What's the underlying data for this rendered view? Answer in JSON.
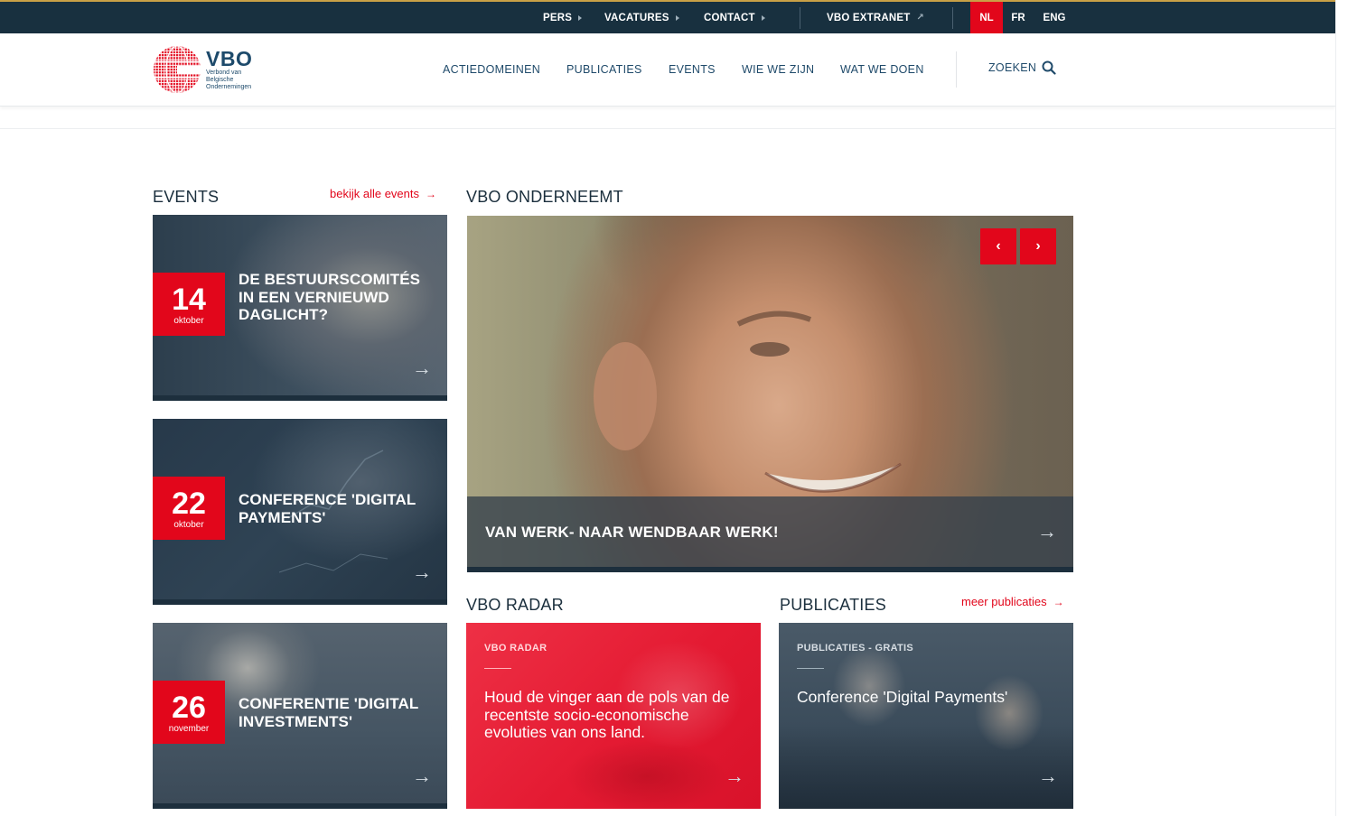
{
  "topbar": {
    "links": [
      "PERS",
      "VACATURES",
      "CONTACT"
    ],
    "extranet": "VBO EXTRANET",
    "languages": [
      "NL",
      "FR",
      "ENG"
    ],
    "active_language": "NL"
  },
  "header": {
    "logo_title": "VBO",
    "logo_subtitle": "Verbond van Belgische Ondernemingen",
    "nav": [
      "ACTIEDOMEINEN",
      "PUBLICATIES",
      "EVENTS",
      "WIE WE ZIJN",
      "WAT WE DOEN"
    ],
    "search_label": "ZOEKEN"
  },
  "events": {
    "heading": "EVENTS",
    "more_link": "bekijk alle events",
    "items": [
      {
        "day": "14",
        "month": "oktober",
        "title": "DE BESTUURSCOMITÉS IN EEN VERNIEUWD DAGLICHT?"
      },
      {
        "day": "22",
        "month": "oktober",
        "title": "CONFERENCE 'DIGITAL PAYMENTS'"
      },
      {
        "day": "26",
        "month": "november",
        "title": "CONFERENTIE 'DIGITAL INVESTMENTS'"
      }
    ]
  },
  "onderneemt": {
    "heading": "VBO ONDERNEEMT",
    "caption": "VAN WERK- NAAR WENDBAAR WERK!"
  },
  "radar": {
    "heading": "VBO RADAR",
    "label": "VBO RADAR",
    "text": "Houd de vinger aan de pols van de recentste socio-economische evoluties van ons land."
  },
  "publicaties": {
    "heading": "PUBLICATIES",
    "more_link": "meer publicaties",
    "label": "PUBLICATIES - GRATIS",
    "text": "Conference 'Digital Payments'"
  },
  "colors": {
    "brand_red": "#e2061b",
    "navy": "#18303f",
    "accent_gold": "#c9a046"
  },
  "icons": {
    "search": "search-icon",
    "arrow": "arrow-right-icon",
    "external": "external-link-icon",
    "prev": "chevron-left-icon",
    "next": "chevron-right-icon"
  }
}
